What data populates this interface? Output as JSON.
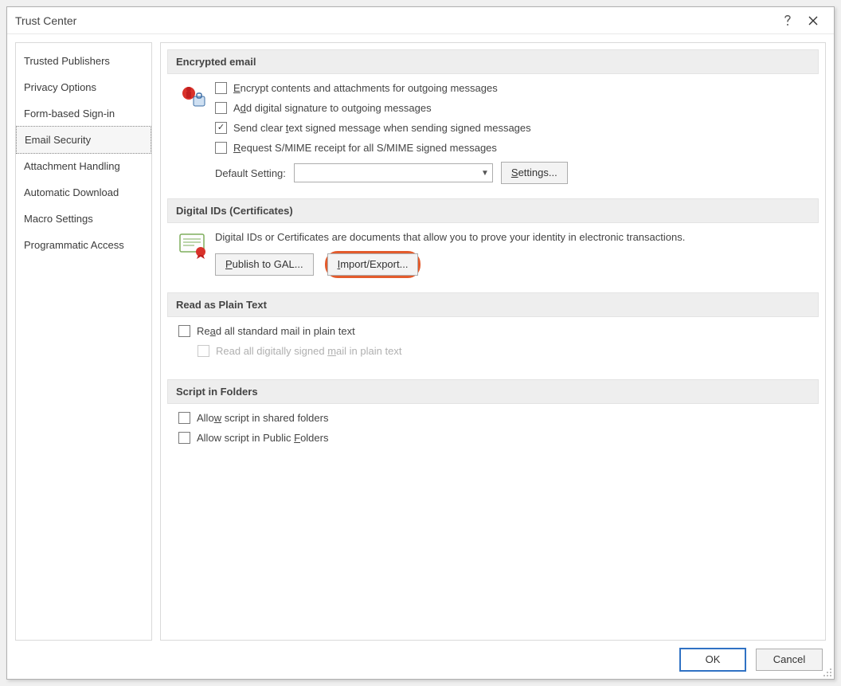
{
  "window": {
    "title": "Trust Center"
  },
  "sidebar": {
    "items": [
      {
        "label": "Trusted Publishers",
        "selected": false
      },
      {
        "label": "Privacy Options",
        "selected": false
      },
      {
        "label": "Form-based Sign-in",
        "selected": false
      },
      {
        "label": "Email Security",
        "selected": true
      },
      {
        "label": "Attachment Handling",
        "selected": false
      },
      {
        "label": "Automatic Download",
        "selected": false
      },
      {
        "label": "Macro Settings",
        "selected": false
      },
      {
        "label": "Programmatic Access",
        "selected": false
      }
    ]
  },
  "sections": {
    "encrypted": {
      "header": "Encrypted email",
      "chk_encrypt": "Encrypt contents and attachments for outgoing messages",
      "chk_add_sig": "Add digital signature to outgoing messages",
      "chk_clear_text": "Send clear text signed message when sending signed messages",
      "chk_clear_text_checked": true,
      "chk_request_smime": "Request S/MIME receipt for all S/MIME signed messages",
      "default_setting_label": "Default Setting:",
      "settings_button": "Settings..."
    },
    "digital_ids": {
      "header": "Digital IDs (Certificates)",
      "desc": "Digital IDs or Certificates are documents that allow you to prove your identity in electronic transactions.",
      "publish_button": "Publish to GAL...",
      "import_export_button": "Import/Export..."
    },
    "plain_text": {
      "header": "Read as Plain Text",
      "chk_read_all": "Read all standard mail in plain text",
      "chk_read_signed": "Read all digitally signed mail in plain text"
    },
    "script": {
      "header": "Script in Folders",
      "chk_shared": "Allow script in shared folders",
      "chk_public": "Allow script in Public Folders"
    }
  },
  "footer": {
    "ok": "OK",
    "cancel": "Cancel"
  }
}
